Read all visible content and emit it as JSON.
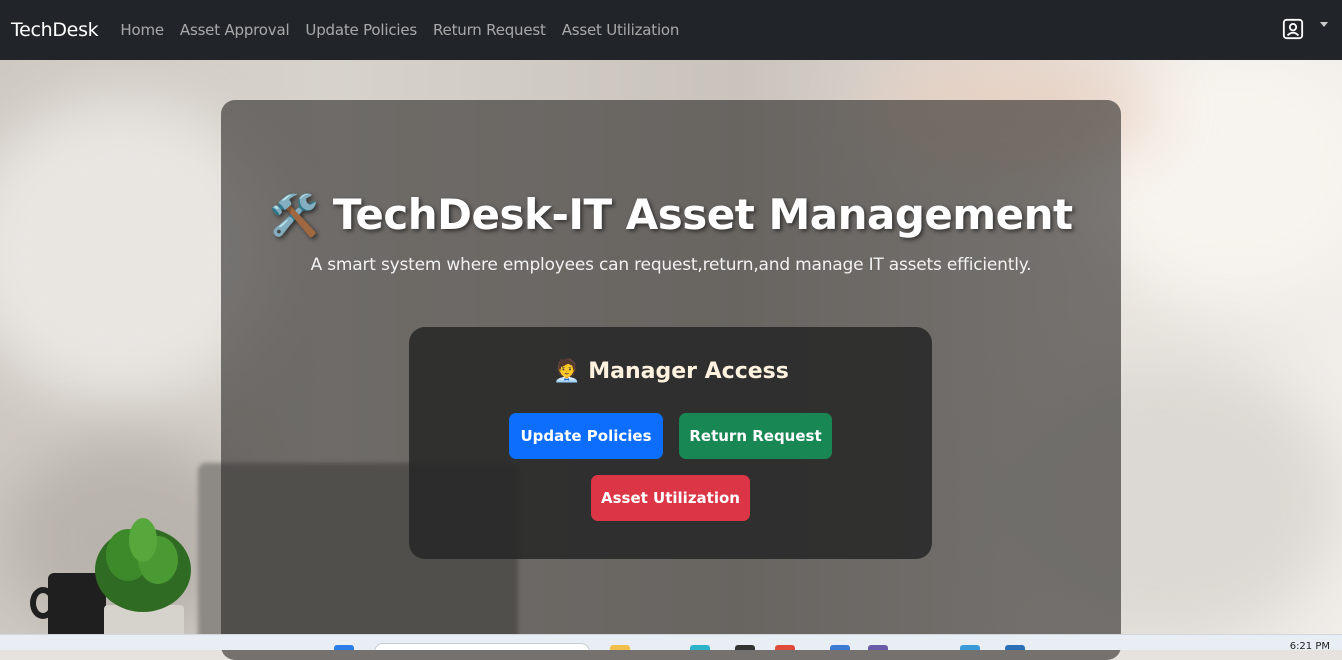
{
  "navbar": {
    "brand": "TechDesk",
    "links": [
      "Home",
      "Asset Approval",
      "Update Policies",
      "Return Request",
      "Asset Utilization"
    ],
    "user_icon": "user-badge-icon",
    "dropdown_icon": "caret-down-icon"
  },
  "hero": {
    "icon": "🛠️",
    "title": "TechDesk-IT Asset Management",
    "subtitle": "A smart system where employees can request,return,and manage IT assets efficiently."
  },
  "access": {
    "icon": "🧑‍💼",
    "title": "Manager Access",
    "buttons": {
      "update_policies": "Update Policies",
      "return_request": "Return Request",
      "asset_utilization": "Asset Utilization"
    }
  },
  "taskbar": {
    "time": "6:21 PM"
  },
  "colors": {
    "navbar": "#212529",
    "primary": "#0d6efd",
    "success": "#198754",
    "danger": "#dc3545"
  }
}
